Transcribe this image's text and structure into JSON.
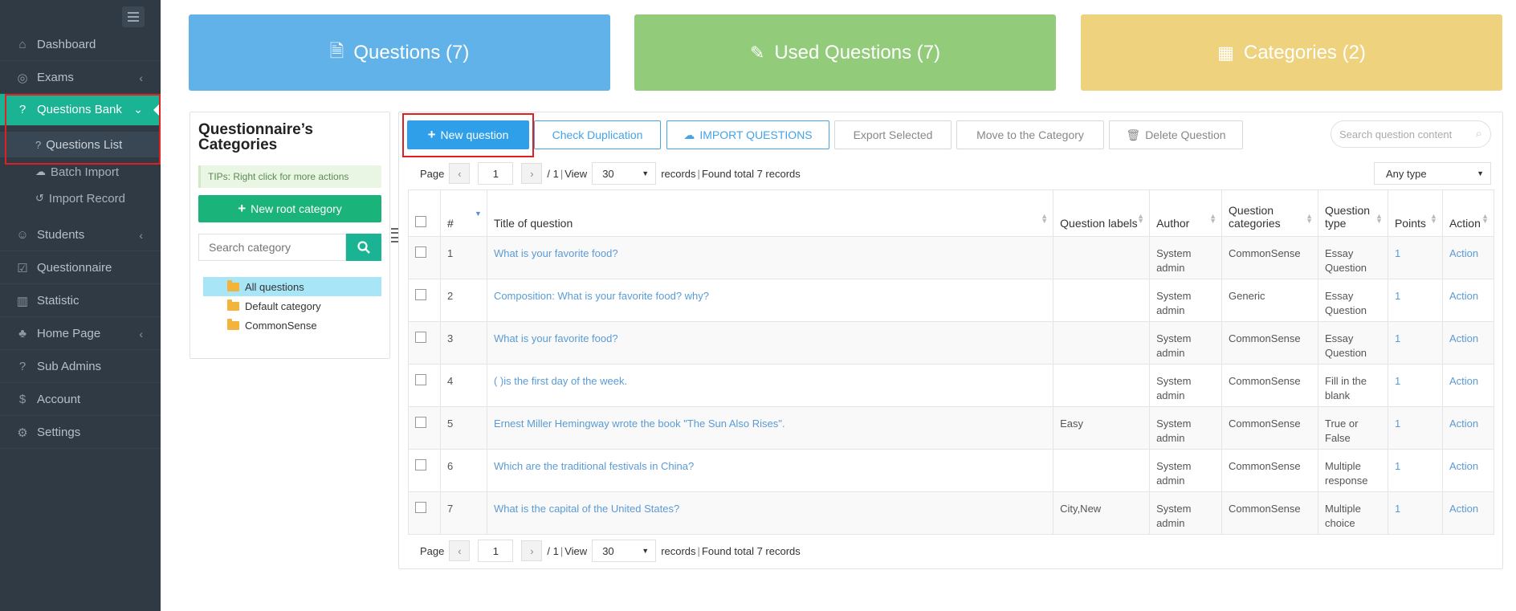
{
  "sidebar": {
    "items": [
      {
        "label": "Dashboard",
        "icon": "home-icon"
      },
      {
        "label": "Exams",
        "icon": "check-circle-icon"
      },
      {
        "label": "Questions Bank",
        "icon": "question-circle-icon"
      },
      {
        "label": "Students",
        "icon": "users-icon"
      },
      {
        "label": "Questionnaire",
        "icon": "checkbox-icon"
      },
      {
        "label": "Statistic",
        "icon": "bar-chart-icon"
      },
      {
        "label": "Home Page",
        "icon": "tree-icon"
      },
      {
        "label": "Sub Admins",
        "icon": "question-circle-icon"
      },
      {
        "label": "Account",
        "icon": "dollar-icon"
      },
      {
        "label": "Settings",
        "icon": "gear-icon"
      }
    ],
    "sub_items": [
      {
        "label": "Questions List",
        "icon": "question-circle-icon"
      },
      {
        "label": "Batch Import",
        "icon": "cloud-upload-icon"
      },
      {
        "label": "Import Record",
        "icon": "history-icon"
      }
    ]
  },
  "cards": {
    "questions": "Questions (7)",
    "used": "Used Questions (7)",
    "categories": "Categories (2)"
  },
  "categories_panel": {
    "title": "Questionnaire’s Categories",
    "tips": "TIPs: Right click for more actions",
    "new_root": "New root category",
    "search_placeholder": "Search category",
    "tree": [
      "All questions",
      "Default category",
      "CommonSense"
    ]
  },
  "toolbar": {
    "new_question": "New question",
    "check_dup": "Check Duplication",
    "import": "IMPORT QUESTIONS",
    "export": "Export Selected",
    "move": "Move to the Category",
    "delete": "Delete Question",
    "search_placeholder": "Search question content"
  },
  "pager": {
    "page_label": "Page",
    "page_value": "1",
    "total_pages": "/ 1",
    "view_label": "View",
    "view_value": "30",
    "records_text": "records",
    "found_text": "Found total 7 records"
  },
  "type_filter": "Any type",
  "table": {
    "headers": [
      "#",
      "Title of question",
      "Question labels",
      "Author",
      "Question categories",
      "Question type",
      "Points",
      "Action"
    ],
    "rows": [
      {
        "n": "1",
        "title": "What is your favorite food?",
        "labels": "",
        "author": "System admin",
        "category": "CommonSense",
        "type": "Essay Question",
        "points": "1",
        "action": "Action"
      },
      {
        "n": "2",
        "title": "Composition: What is your favorite food? why?",
        "labels": "",
        "author": "System admin",
        "category": "Generic",
        "type": "Essay Question",
        "points": "1",
        "action": "Action"
      },
      {
        "n": "3",
        "title": "What is your favorite food?",
        "labels": "",
        "author": "System admin",
        "category": "CommonSense",
        "type": "Essay Question",
        "points": "1",
        "action": "Action"
      },
      {
        "n": "4",
        "title": "(   )is the first day of the week.",
        "labels": "",
        "author": "System admin",
        "category": "CommonSense",
        "type": "Fill in the blank",
        "points": "1",
        "action": "Action"
      },
      {
        "n": "5",
        "title": "Ernest Miller Hemingway wrote the book \"The Sun Also Rises\".",
        "labels": "Easy",
        "author": "System admin",
        "category": "CommonSense",
        "type": "True or False",
        "points": "1",
        "action": "Action"
      },
      {
        "n": "6",
        "title": "Which are the traditional festivals in China?",
        "labels": "",
        "author": "System admin",
        "category": "CommonSense",
        "type": "Multiple response",
        "points": "1",
        "action": "Action"
      },
      {
        "n": "7",
        "title": "What is the capital of the United States?",
        "labels": "City,New",
        "author": "System admin",
        "category": "CommonSense",
        "type": "Multiple choice",
        "points": "1",
        "action": "Action"
      }
    ]
  }
}
